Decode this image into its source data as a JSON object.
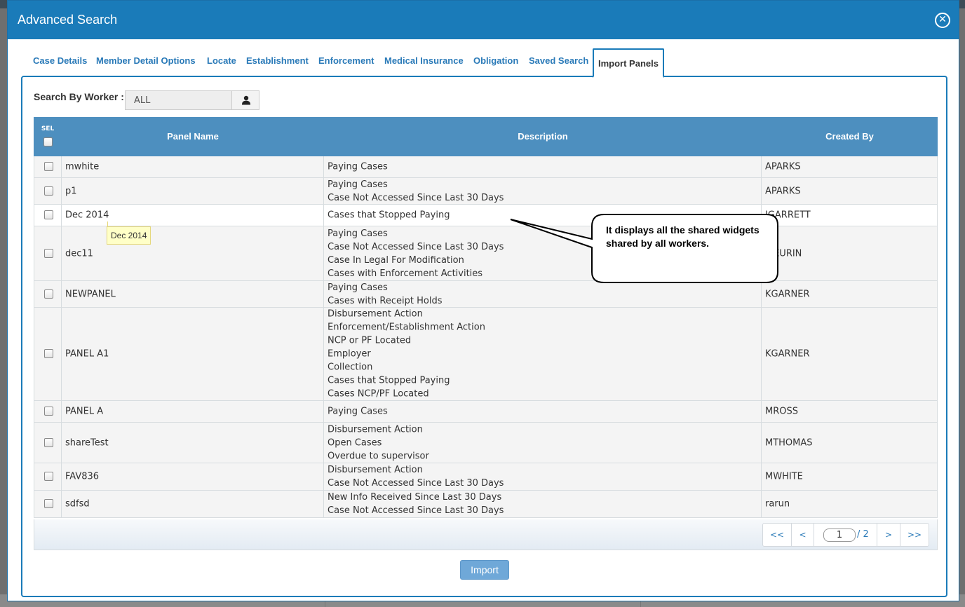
{
  "dialog": {
    "title": "Advanced Search",
    "close_icon": "close-circle-icon"
  },
  "tabs": [
    {
      "label": "Case Details",
      "active": false
    },
    {
      "label": "Member Detail Options",
      "active": false
    },
    {
      "label": "Locate",
      "active": false
    },
    {
      "label": "Establishment",
      "active": false
    },
    {
      "label": "Enforcement",
      "active": false
    },
    {
      "label": "Medical Insurance",
      "active": false
    },
    {
      "label": "Obligation",
      "active": false
    },
    {
      "label": "Saved Search",
      "active": false
    },
    {
      "label": "Import Panels",
      "active": true
    }
  ],
  "worker_search": {
    "label": "Search By Worker :",
    "value": "ALL",
    "button_icon": "user-icon"
  },
  "table": {
    "headers": {
      "sel": "SEL",
      "panel_name": "Panel Name",
      "description": "Description",
      "created_by": "Created By"
    },
    "rows": [
      {
        "name": "mwhite",
        "description": [
          "Paying Cases"
        ],
        "created_by": "APARKS"
      },
      {
        "name": "p1",
        "description": [
          "Paying Cases",
          "Case Not Accessed Since Last 30 Days"
        ],
        "created_by": "APARKS"
      },
      {
        "name": "Dec 2014",
        "description": [
          "Cases that Stopped Paying"
        ],
        "created_by": "IGARRETT"
      },
      {
        "name": "dec11",
        "description": [
          "Paying Cases",
          "Case Not Accessed Since Last 30 Days",
          "Case In Legal For Modification",
          "Cases with Enforcement Activities"
        ],
        "created_by": "JSEURIN"
      },
      {
        "name": "NEWPANEL",
        "description": [
          "Paying Cases",
          "Cases with Receipt Holds"
        ],
        "created_by": "KGARNER"
      },
      {
        "name": "PANEL A1",
        "description": [
          "Disbursement Action",
          "Enforcement/Establishment Action",
          "NCP or PF Located",
          "Employer",
          "Collection",
          "Cases that Stopped Paying",
          "Cases NCP/PF Located"
        ],
        "created_by": "KGARNER"
      },
      {
        "name": "PANEL A",
        "description": [
          "Paying Cases"
        ],
        "created_by": "MROSS"
      },
      {
        "name": "shareTest",
        "description": [
          "Disbursement Action",
          "Open Cases",
          "Overdue to supervisor"
        ],
        "created_by": "MTHOMAS"
      },
      {
        "name": "FAV836",
        "description": [
          "Disbursement Action",
          "Case Not Accessed Since Last 30 Days"
        ],
        "created_by": "MWHITE"
      },
      {
        "name": "sdfsd",
        "description": [
          "New Info Received Since Last 30 Days",
          "Case Not Accessed Since Last 30 Days"
        ],
        "created_by": "rarun"
      }
    ]
  },
  "pager": {
    "first": "<<",
    "prev": "<",
    "current": "1",
    "total": "/ 2",
    "next": ">",
    "last": ">>"
  },
  "import_button": "Import",
  "tooltip": "Dec 2014",
  "callout": "It displays all the shared widgets shared by all workers."
}
